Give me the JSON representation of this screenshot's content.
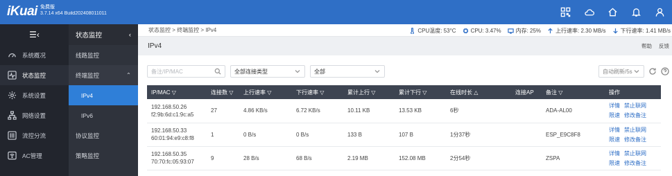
{
  "brand": {
    "logo": "iKuai",
    "edition": "免费版",
    "version": "3.7.14 x64 Build202408011011",
    "icons": [
      "qr-icon",
      "cloud-icon",
      "home-icon",
      "bell-icon",
      "user-icon"
    ]
  },
  "nav1": {
    "toggle": "☰‹",
    "items": [
      {
        "label": "系统概况",
        "icon": "gauge-icon"
      },
      {
        "label": "状态监控",
        "icon": "pulse-icon"
      },
      {
        "label": "系统设置",
        "icon": "gear-icon"
      },
      {
        "label": "网络设置",
        "icon": "network-icon"
      },
      {
        "label": "流控分流",
        "icon": "sliders-icon"
      },
      {
        "label": "AC管理",
        "icon": "wifi-icon"
      }
    ]
  },
  "nav2": {
    "header": "状态监控",
    "items": [
      "线路监控",
      "终端监控",
      "协议监控",
      "策略监控"
    ],
    "subitems": [
      "IPv4",
      "IPv6"
    ]
  },
  "breadcrumb": "状态监控 > 终端监控 > IPv4",
  "stats": {
    "cpu_temp": "CPU温度: 53°C",
    "cpu": "CPU: 3.47%",
    "memory": "内存: 25%",
    "upload": "上行速率: 2.30 MB/s",
    "download": "下行速率: 1.41 MB/s"
  },
  "page": {
    "title": "IPv4",
    "help": "帮助",
    "feedback": "反馈"
  },
  "filters": {
    "search_placeholder": "备注/IP/MAC",
    "conn_type": "全部连接类型",
    "scope": "全部",
    "refresh": "自动刷新/5s"
  },
  "table": {
    "columns": [
      "IP/MAC ▽",
      "连接数 ▽",
      "上行速率 ▽",
      "下行速率 ▽",
      "累计上行 ▽",
      "累计下行 ▽",
      "在线时长 △",
      "连接AP",
      "备注 ▽",
      "操作"
    ],
    "rows": [
      {
        "ip": "192.168.50.26",
        "mac": "f2:9b:6d:c1:9c:a5",
        "conns": "27",
        "up": "4.86 KB/s",
        "down": "6.72 KB/s",
        "total_up": "10.11 KB",
        "total_down": "13.53 KB",
        "online": "6秒",
        "ap": "",
        "note": "ADA-AL00"
      },
      {
        "ip": "192.168.50.33",
        "mac": "60:01:94:e9:c8:f8",
        "conns": "1",
        "up": "0 B/s",
        "down": "0 B/s",
        "total_up": "133 B",
        "total_down": "107 B",
        "online": "1分37秒",
        "ap": "",
        "note": "ESP_E9C8F8"
      },
      {
        "ip": "192.168.50.35",
        "mac": "70:70:fc:05:93:07",
        "conns": "9",
        "up": "28 B/s",
        "down": "68 B/s",
        "total_up": "2.19 MB",
        "total_down": "152.08 MB",
        "online": "2分54秒",
        "ap": "",
        "note": "ZSPA"
      }
    ],
    "ops": {
      "detail": "详情",
      "block": "禁止联网",
      "limit": "限速",
      "edit_note": "修改备注"
    }
  }
}
